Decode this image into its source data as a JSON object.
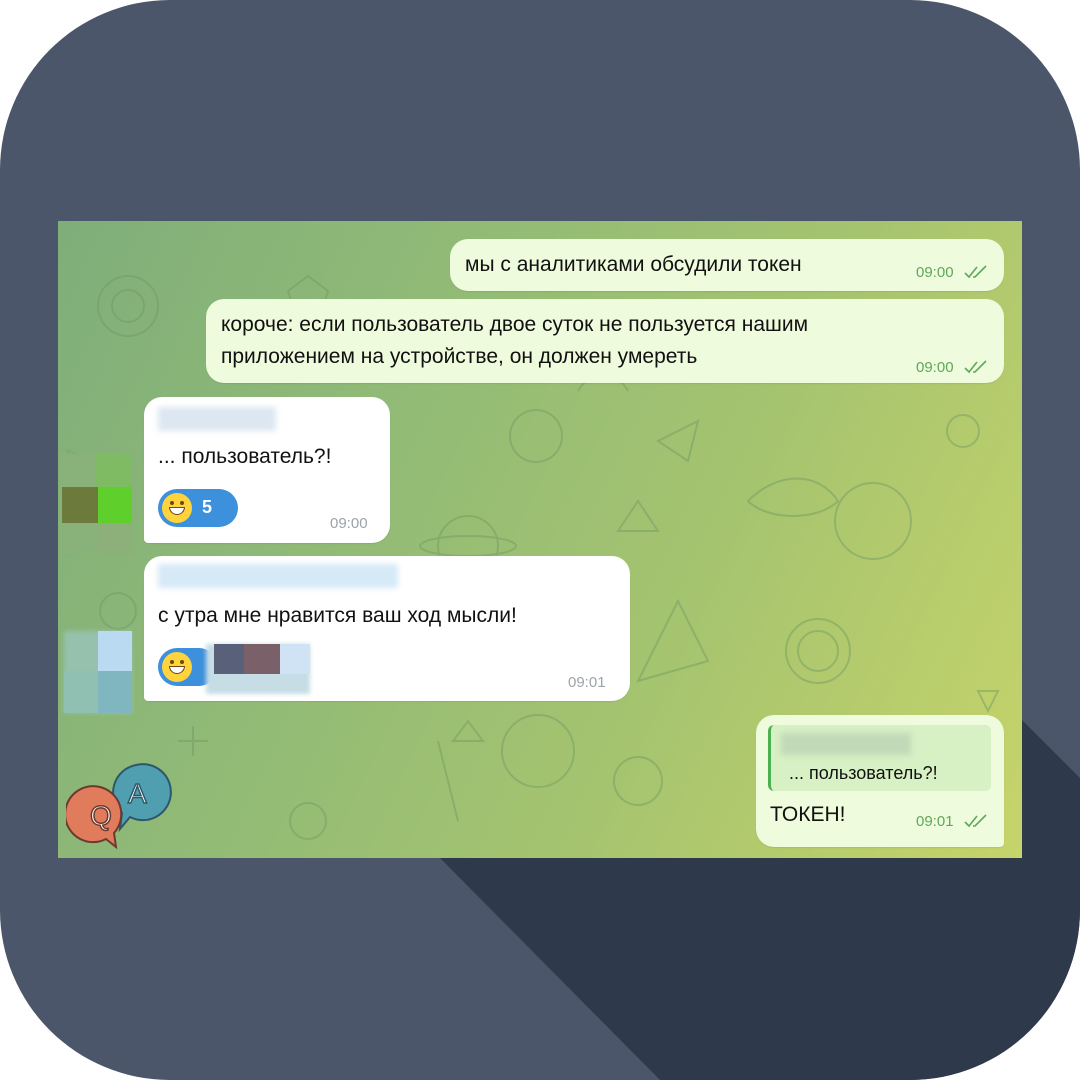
{
  "chat": {
    "messages": [
      {
        "text": "мы с аналитиками обсудили токен",
        "time": "09:00",
        "direction": "outgoing",
        "status": "read"
      },
      {
        "text": "короче: если пользователь двое суток не пользуется нашим приложением на устройстве, он должен умереть",
        "line1": "короче: если пользователь двое суток не пользуется нашим",
        "line2": "приложением на устройстве, он должен умереть",
        "time": "09:00",
        "direction": "outgoing",
        "status": "read"
      },
      {
        "text": "... пользователь?!",
        "time": "09:00",
        "direction": "incoming",
        "reaction": {
          "emoji": "grinning-face",
          "count": "5"
        }
      },
      {
        "text": "с утра мне нравится ваш ход мысли!",
        "time": "09:01",
        "direction": "incoming",
        "reaction": {
          "emoji": "grinning-face"
        }
      },
      {
        "quote": "... пользователь?!",
        "text": "ТОКЕН!",
        "time": "09:01",
        "direction": "outgoing",
        "status": "read"
      }
    ]
  },
  "badge": {
    "q": "Q",
    "a": "A"
  },
  "colors": {
    "tile": "#4b566b",
    "long_shadow": "#2f394c",
    "outgoing_bubble": "#eefbdc",
    "incoming_bubble": "#ffffff",
    "read_ticks": "#5fa85a",
    "reaction": "#3d90dc",
    "quote_bar": "#4caf50"
  }
}
